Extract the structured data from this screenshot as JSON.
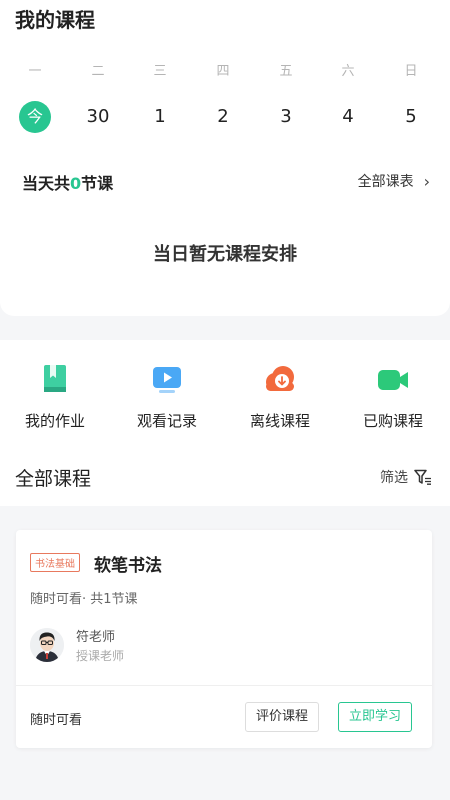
{
  "header": {
    "title": "我的课程"
  },
  "calendar": {
    "weekdays": [
      "一",
      "二",
      "三",
      "四",
      "五",
      "六",
      "日"
    ],
    "dates": [
      "今",
      "30",
      "1",
      "2",
      "3",
      "4",
      "5"
    ]
  },
  "summary": {
    "prefix": "当天共",
    "count": "0",
    "suffix": "节课",
    "all_schedule_label": "全部课表",
    "empty_text": "当日暂无课程安排"
  },
  "shortcuts": [
    {
      "label": "我的作业",
      "icon": "homework-book-icon",
      "color": "#3ecfa1"
    },
    {
      "label": "观看记录",
      "icon": "watch-history-icon",
      "color": "#4aa8f5"
    },
    {
      "label": "离线课程",
      "icon": "offline-download-icon",
      "color": "#f26a3d"
    },
    {
      "label": "已购课程",
      "icon": "video-camera-icon",
      "color": "#2cc97a"
    }
  ],
  "section": {
    "title": "全部课程",
    "filter_label": "筛选"
  },
  "course": {
    "tag": "书法基础",
    "name": "软笔书法",
    "meta": "随时可看· 共1节课",
    "teacher_name": "符老师",
    "teacher_role": "授课老师",
    "footer_text": "随时可看",
    "review_button": "评价课程",
    "study_button": "立即学习"
  },
  "colors": {
    "accent": "#28c691",
    "tag": "#e8795e"
  }
}
